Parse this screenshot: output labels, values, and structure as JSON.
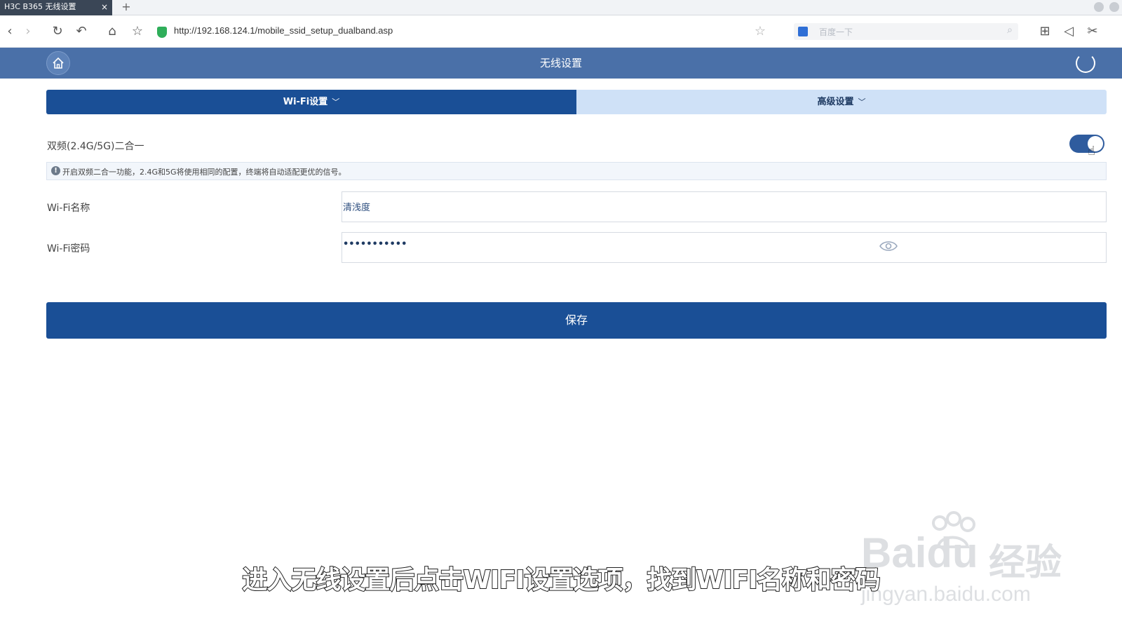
{
  "browser": {
    "tab_title": "H3C B365 无线设置",
    "tab_close": "×",
    "new_tab": "+",
    "url": "http://192.168.124.1/mobile_ssid_setup_dualband.asp",
    "search_placeholder": "百度一下"
  },
  "app": {
    "title": "无线设置"
  },
  "tabs": [
    {
      "label": "Wi-Fi设置",
      "active": true
    },
    {
      "label": "高级设置",
      "active": false
    }
  ],
  "form": {
    "dualband_label": "双频(2.4G/5G)二合一",
    "dualband_enabled": true,
    "info_text": "开启双频二合一功能，2.4G和5G将使用相同的配置，终端将自动适配更优的信号。",
    "ssid_label": "Wi-Fi名称",
    "ssid_value": "清浅度",
    "password_label": "Wi-Fi密码",
    "password_value": "•••••••••••",
    "save_label": "保存"
  },
  "caption": "进入无线设置后点击WIFI设置选项，找到WIFI名称和密码",
  "watermark": {
    "logo": "Bai",
    "logo2": "du",
    "cn": "经验",
    "url": "jingyan.baidu.com"
  },
  "colors": {
    "header": "#4a70a8",
    "primary": "#1a4f96",
    "tab_inactive": "#cfe1f7"
  }
}
